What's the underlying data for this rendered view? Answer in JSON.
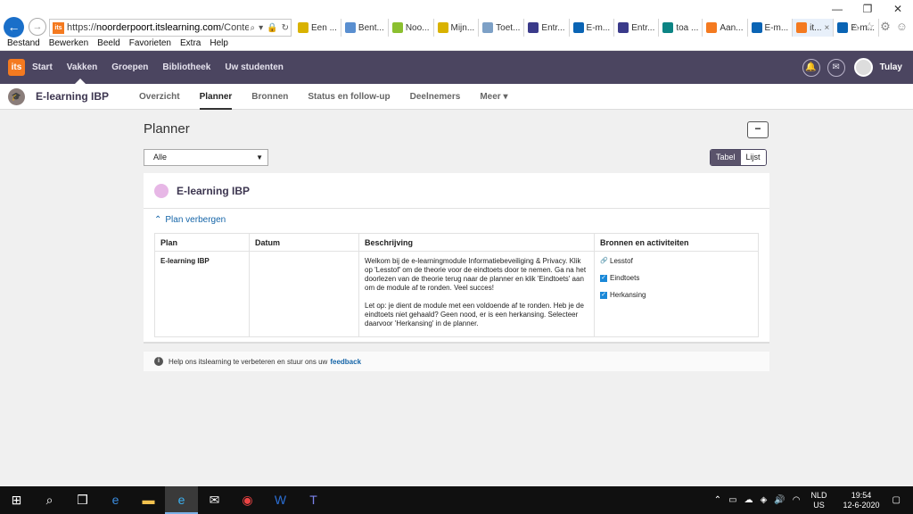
{
  "browser": {
    "url_prefix": "https://",
    "url_domain": "noorderpoort.itslearning.com",
    "url_path": "/ContentArea.",
    "tabs": [
      {
        "label": "Een ...",
        "color": "#d9b200",
        "icon": "infinity-icon"
      },
      {
        "label": "Bent...",
        "color": "#5a8fd0",
        "icon": "site-icon"
      },
      {
        "label": "Noo...",
        "color": "#8bbf2f",
        "icon": "chat-icon"
      },
      {
        "label": "Mijn...",
        "color": "#d9b200",
        "icon": "infinity-icon"
      },
      {
        "label": "Toet...",
        "color": "#7da0c6",
        "icon": "doc-icon"
      },
      {
        "label": "Entr...",
        "color": "#3a3a8a",
        "icon": "key-icon"
      },
      {
        "label": "E-m...",
        "color": "#0a64b4",
        "icon": "outlook-icon"
      },
      {
        "label": "Entr...",
        "color": "#3a3a8a",
        "icon": "key-icon"
      },
      {
        "label": "toa ...",
        "color": "#0c8484",
        "icon": "bing-icon"
      },
      {
        "label": "Aan...",
        "color": "#f47a20",
        "icon": "its-icon"
      },
      {
        "label": "E-m...",
        "color": "#0a64b4",
        "icon": "outlook-icon"
      },
      {
        "label": "it...",
        "color": "#f47a20",
        "icon": "its-icon"
      },
      {
        "label": "E-m...",
        "color": "#0a64b4",
        "icon": "outlook-icon"
      }
    ],
    "menu": [
      "Bestand",
      "Bewerken",
      "Beeld",
      "Favorieten",
      "Extra",
      "Help"
    ]
  },
  "topnav": {
    "logo": "its",
    "items": [
      "Start",
      "Vakken",
      "Groepen",
      "Bibliotheek",
      "Uw studenten"
    ],
    "user": "Tulay"
  },
  "subnav": {
    "course": "E-learning IBP",
    "items": [
      "Overzicht",
      "Planner",
      "Bronnen",
      "Status en follow-up",
      "Deelnemers",
      "Meer"
    ]
  },
  "planner": {
    "title": "Planner",
    "filter": "Alle",
    "view_tabel": "Tabel",
    "view_lijst": "Lijst",
    "card_title": "E-learning IBP",
    "hide_plan": "Plan verbergen",
    "columns": [
      "Plan",
      "Datum",
      "Beschrijving",
      "Bronnen en activiteiten"
    ],
    "row": {
      "plan": "E-learning IBP",
      "datum": "",
      "desc_p1": "Welkom bij de e-learningmodule Informatiebeveiliging & Privacy. Klik op 'Lesstof' om de theorie voor de eindtoets door te nemen. Ga na het doorlezen van de theorie terug naar de planner en klik 'Eindtoets' aan om de module af te ronden. Veel succes!",
      "desc_p2": "Let op: je dient de module met een voldoende af te ronden. Heb je de eindtoets niet gehaald? Geen nood, er is een herkansing. Selecteer daarvoor 'Herkansing' in de planner.",
      "resources": [
        "Lesstof",
        "Eindtoets",
        "Herkansing"
      ]
    },
    "feedback_text": "Help ons itslearning te verbeteren en stuur ons uw",
    "feedback_link": "feedback"
  },
  "taskbar": {
    "lang_1": "NLD",
    "lang_2": "US",
    "time": "19:54",
    "date": "12-6-2020"
  }
}
